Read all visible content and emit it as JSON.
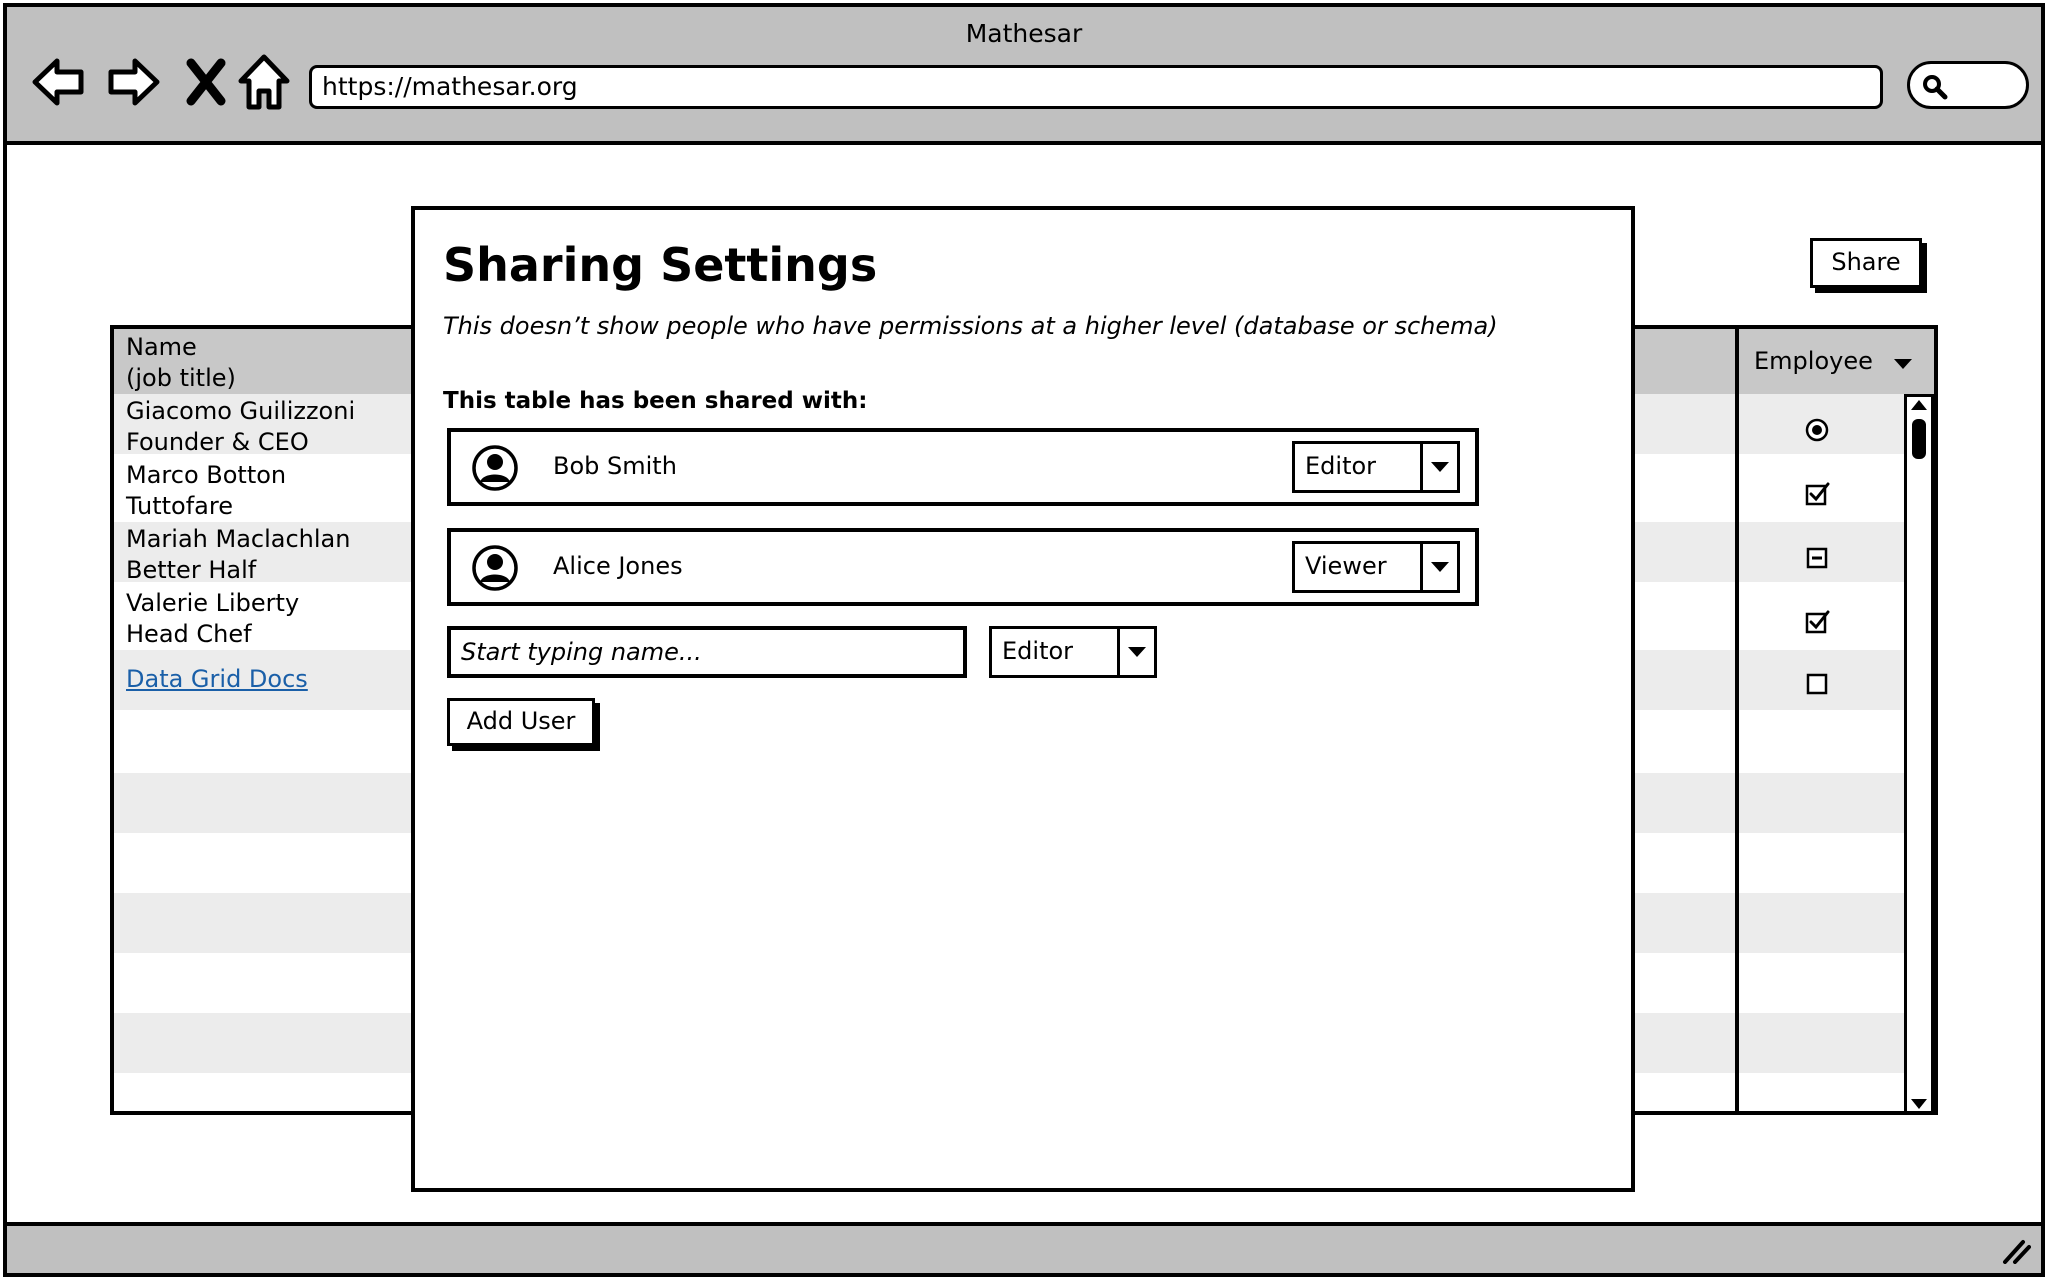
{
  "window": {
    "title": "Mathesar"
  },
  "browser": {
    "url": "https://mathesar.org",
    "nav_icons": [
      "back-arrow-icon",
      "forward-arrow-icon",
      "close-icon",
      "home-icon"
    ]
  },
  "toolbar": {
    "share_label": "Share"
  },
  "grid": {
    "header": {
      "name_line1": "Name",
      "name_line2": "(job title)",
      "employee": "Employee"
    },
    "rows": [
      {
        "name": "Giacomo Guilizzoni",
        "title": "Founder & CEO",
        "control": "radio-selected"
      },
      {
        "name": "Marco Botton",
        "title": "Tuttofare",
        "control": "checkbox-checked"
      },
      {
        "name": "Mariah Maclachlan",
        "title": "Better Half",
        "control": "checkbox-indeterminate"
      },
      {
        "name": "Valerie Liberty",
        "title": "Head Chef",
        "control": "checkbox-checked"
      }
    ],
    "link": "Data Grid Docs",
    "link_row_control": "checkbox-empty"
  },
  "modal": {
    "title": "Sharing Settings",
    "note": "This doesn’t show people who have permissions at a higher level (database or schema)",
    "shared_heading": "This table has been shared with:",
    "users": [
      {
        "name": "Bob Smith",
        "role": "Editor"
      },
      {
        "name": "Alice Jones",
        "role": "Viewer"
      }
    ],
    "new_user": {
      "placeholder": "Start typing name...",
      "role": "Editor"
    },
    "add_label": "Add User"
  },
  "colors": {
    "chrome": "#c0c0c0",
    "stripe": "#ececec",
    "link": "#1a5fa8"
  }
}
